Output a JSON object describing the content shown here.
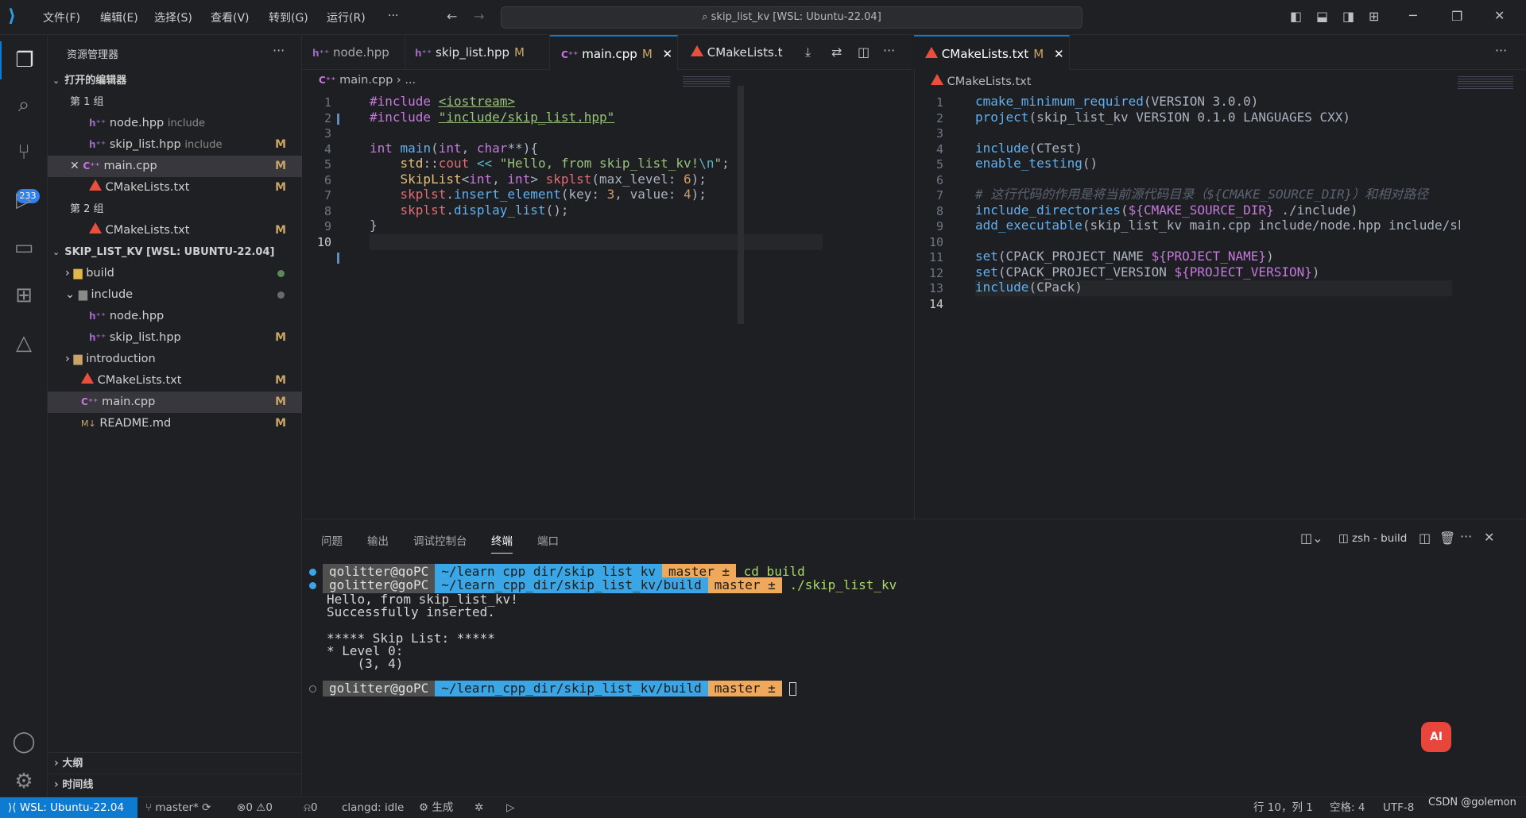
{
  "titlebar": {
    "menus": [
      "文件(F)",
      "编辑(E)",
      "选择(S)",
      "查看(V)",
      "转到(G)",
      "运行(R)",
      "···"
    ],
    "search": "skip_list_kv [WSL: Ubuntu-22.04]"
  },
  "activity": {
    "scm_badge": "233"
  },
  "sidebar": {
    "title": "资源管理器",
    "open_editors": "打开的编辑器",
    "group1": "第 1 组",
    "group2": "第 2 组",
    "open_items": [
      {
        "name": "node.hpp",
        "desc": "include",
        "mark": ""
      },
      {
        "name": "skip_list.hpp",
        "desc": "include",
        "mark": "M"
      },
      {
        "name": "main.cpp",
        "desc": "",
        "mark": "M"
      },
      {
        "name": "CMakeLists.txt",
        "desc": "",
        "mark": "M"
      },
      {
        "name": "CMakeLists.txt",
        "desc": "",
        "mark": "M"
      }
    ],
    "project": "SKIP_LIST_KV [WSL: UBUNTU-22.04]",
    "tree": [
      {
        "name": "build",
        "mark": ""
      },
      {
        "name": "include",
        "mark": ""
      },
      {
        "name": "node.hpp",
        "mark": ""
      },
      {
        "name": "skip_list.hpp",
        "mark": "M"
      },
      {
        "name": "introduction",
        "mark": ""
      },
      {
        "name": "CMakeLists.txt",
        "mark": "M"
      },
      {
        "name": "main.cpp",
        "mark": "M"
      },
      {
        "name": "README.md",
        "mark": "M"
      }
    ],
    "outline": "大纲",
    "timeline": "时间线"
  },
  "tabs_left": [
    {
      "name": "node.hpp",
      "mark": ""
    },
    {
      "name": "skip_list.hpp",
      "mark": "M"
    },
    {
      "name": "main.cpp",
      "mark": "M"
    },
    {
      "name": "CMakeLists.t",
      "mark": ""
    }
  ],
  "tabs_right": [
    {
      "name": "CMakeLists.txt",
      "mark": "M"
    }
  ],
  "editor_left": {
    "crumb_file": "main.cpp",
    "crumb_rest": "...",
    "line_numbers": [
      "1",
      "2",
      "3",
      "4",
      "5",
      "6",
      "7",
      "8",
      "9",
      "10"
    ]
  },
  "editor_right": {
    "crumb_file": "CMakeLists.txt",
    "line_numbers": [
      "1",
      "2",
      "3",
      "4",
      "5",
      "6",
      "7",
      "8",
      "9",
      "10",
      "11",
      "12",
      "13",
      "14"
    ]
  },
  "panel": {
    "tabs": [
      "问题",
      "输出",
      "调试控制台",
      "终端",
      "端口"
    ],
    "shell": "zsh - build",
    "prompt_user": "golitter@goPC",
    "path1": "~/learn_cpp_dir/skip_list_kv",
    "path2": "~/learn_cpp_dir/skip_list_kv/build",
    "branch": "master ±",
    "cmd1": "cd build",
    "cmd2": "./skip_list_kv",
    "output": [
      "Hello, from skip_list_kv!",
      "Successfully inserted.",
      "",
      "***** Skip List: *****",
      "* Level 0:",
      "    (3, 4)"
    ]
  },
  "status": {
    "remote": "WSL: Ubuntu-22.04",
    "branch": "master*",
    "errors": "0",
    "warnings": "0",
    "ports": "0",
    "clangd": "clangd: idle",
    "build": "生成",
    "position": "行 10，列 1",
    "spaces": "空格: 4",
    "encoding": "UTF-8",
    "watermark": "CSDN @golemon"
  }
}
